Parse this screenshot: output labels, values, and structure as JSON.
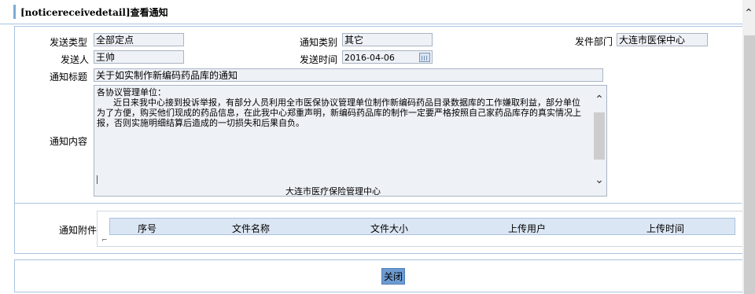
{
  "page_title": "[noticereceivedetail]查看通知",
  "form": {
    "send_type_label": "发送类型",
    "send_type_value": "全部定点",
    "notice_category_label": "通知类别",
    "notice_category_value": "其它",
    "send_dept_label": "发件部门",
    "send_dept_value": "大连市医保中心",
    "sender_label": "发送人",
    "sender_value": "王帅",
    "send_time_label": "发送时间",
    "send_time_value": "2016-04-06",
    "notice_title_label": "通知标题",
    "notice_title_value": "关于如实制作新编码药品库的通知",
    "content_label": "通知内容",
    "content_value": "各协议管理单位：\n      近日来我中心接到投诉举报，有部分人员利用全市医保协议管理单位制作新编码药品目录数据库的工作嫌取利益，部分单位为了方便，购买他们现成的药品信息，在此我中心郑重声明，新编码药品库的制作一定要严格按照自己家药品库存的真实情况上报，否则实施明细结算后造成的一切损失和后果自负。",
    "content_signature": "大连市医疗保险管理中心",
    "attachment_label": "通知附件"
  },
  "attachment_table": {
    "columns": [
      "序号",
      "文件名称",
      "文件大小",
      "上传用户",
      "上传时间"
    ],
    "rows": []
  },
  "footer": {
    "close_label": "关闭"
  },
  "icons": {
    "calendar": "calendar-icon",
    "scroll_up": "chevron-up-icon",
    "scroll_down": "chevron-down-icon"
  },
  "colors": {
    "button_bg": "#6d9bd1",
    "header_bg": "#dbe6f4",
    "field_bg": "#eef1f6",
    "border": "#a9c3e0"
  }
}
